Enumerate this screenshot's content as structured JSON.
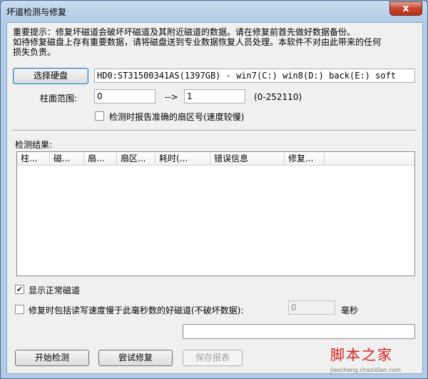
{
  "window": {
    "title": "坏道检测与修复",
    "close_glyph": "x"
  },
  "notice": {
    "line1": "重要提示：修复坏磁道会破坏坏磁道及其附近磁道的数据。请在修复前首先做好数据备份。",
    "line2": "如待修复磁盘上存有重要数据，请将磁盘送到专业数据恢复人员处理。本软件不对由此带来的任何",
    "line3": "损失负责。"
  },
  "disk": {
    "select_label": "选择硬盘",
    "value": "HD0:ST31500341AS(1397GB) - win7(C:) win8(D:) back(E:) soft"
  },
  "cylinder": {
    "label": "柱面范围:",
    "from": "0",
    "arrow": "-->",
    "to": "1",
    "range_hint": "(0-252110)"
  },
  "options": {
    "report_sector_label": "检测时报告准确的扇区号(速度较慢)",
    "report_sector_checked": false,
    "show_normal_label": "显示正常磁道",
    "show_normal_checked": true,
    "repair_slow_label": "修复时包括读写速度慢于此毫秒数的好磁道(不破坏数据):",
    "repair_slow_checked": false,
    "ms_value": "0",
    "ms_unit": "毫秒"
  },
  "results": {
    "label": "检测结果:",
    "columns": [
      "柱...",
      "磁...",
      "扇...",
      "扇区...",
      "耗时(...",
      "错误信息",
      "修复..."
    ]
  },
  "progress": {
    "percent": 0
  },
  "actions": {
    "start": "开始检测",
    "try_repair": "尝试修复",
    "save_report": "保存报表"
  },
  "watermark": {
    "text": "脚本之家",
    "url": "jiaocheng.chazidian.com"
  },
  "colors": {
    "close_button": "#c8452d",
    "watermark": "#d62020"
  }
}
